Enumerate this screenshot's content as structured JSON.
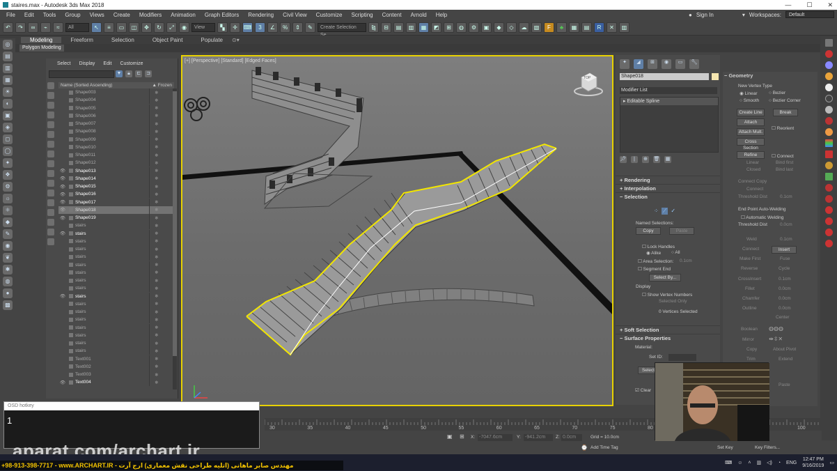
{
  "window": {
    "title": "staires.max - Autodesk 3ds Max 2018",
    "min": "—",
    "max": "☐",
    "close": "✕"
  },
  "menu": {
    "items": [
      "File",
      "Edit",
      "Tools",
      "Group",
      "Views",
      "Create",
      "Modifiers",
      "Animation",
      "Graph Editors",
      "Rendering",
      "Civil View",
      "Customize",
      "Scripting",
      "Content",
      "Arnold",
      "Help"
    ],
    "sign_in": "Sign In",
    "workspaces_label": "Workspaces:",
    "workspaces_value": "Default"
  },
  "toolbar": {
    "filter": "All",
    "view": "View",
    "selection_set": "Create Selection Se"
  },
  "ribbon": {
    "tabs": [
      "Modeling",
      "Freeform",
      "Selection",
      "Object Paint",
      "Populate"
    ],
    "active": "Modeling",
    "sub": "Polygon Modeling"
  },
  "explorer": {
    "menu": [
      "Select",
      "Display",
      "Edit",
      "Customize"
    ],
    "col_name": "Name (Sorted Ascending)",
    "col_frozen": "▲ Frozen",
    "rows": [
      {
        "name": "Shape003",
        "vis": false
      },
      {
        "name": "Shape004",
        "vis": false
      },
      {
        "name": "Shape005",
        "vis": false
      },
      {
        "name": "Shape006",
        "vis": false
      },
      {
        "name": "Shape007",
        "vis": false
      },
      {
        "name": "Shape008",
        "vis": false
      },
      {
        "name": "Shape009",
        "vis": false
      },
      {
        "name": "Shape010",
        "vis": false
      },
      {
        "name": "Shape011",
        "vis": false
      },
      {
        "name": "Shape012",
        "vis": false
      },
      {
        "name": "Shape013",
        "vis": true
      },
      {
        "name": "Shape014",
        "vis": true
      },
      {
        "name": "Shape015",
        "vis": true
      },
      {
        "name": "Shape016",
        "vis": true
      },
      {
        "name": "Shape017",
        "vis": true
      },
      {
        "name": "Shape018",
        "vis": true,
        "sel": true
      },
      {
        "name": "Shape019",
        "vis": true
      },
      {
        "name": "stairs",
        "vis": false
      },
      {
        "name": "stairs",
        "vis": true
      },
      {
        "name": "stairs",
        "vis": false
      },
      {
        "name": "stairs",
        "vis": false
      },
      {
        "name": "stairs",
        "vis": false
      },
      {
        "name": "stairs",
        "vis": false
      },
      {
        "name": "stairs",
        "vis": false
      },
      {
        "name": "stairs",
        "vis": false
      },
      {
        "name": "stairs",
        "vis": false
      },
      {
        "name": "stairs",
        "vis": true
      },
      {
        "name": "stairs",
        "vis": false
      },
      {
        "name": "stairs",
        "vis": false
      },
      {
        "name": "stairs",
        "vis": false
      },
      {
        "name": "stairs",
        "vis": false
      },
      {
        "name": "stairs",
        "vis": false
      },
      {
        "name": "stairs",
        "vis": false
      },
      {
        "name": "stairs",
        "vis": false
      },
      {
        "name": "Text001",
        "vis": false
      },
      {
        "name": "Text002",
        "vis": false
      },
      {
        "name": "Text003",
        "vis": false
      },
      {
        "name": "Text004",
        "vis": true
      }
    ]
  },
  "viewport": {
    "label": "[+] [Perspective] [Standard] [Edged Faces]",
    "cube_label": "TOP"
  },
  "command_panel": {
    "object_name": "Shape018",
    "modifier_list": "Modifier List",
    "stack_item": "Editable Spline",
    "rollouts": {
      "rendering": "Rendering",
      "interpolation": "Interpolation",
      "selection": "Selection",
      "soft_selection": "Soft Selection",
      "surface_properties": "Surface Properties"
    },
    "named_selections": "Named Selections:",
    "copy": "Copy",
    "paste": "Paste",
    "lock_handles": "Lock Handles",
    "alike": "Alike",
    "all": "All",
    "area_selection": "Area Selection:",
    "area_value": "0.1cm",
    "segment_end": "Segment End",
    "select_by": "Select By...",
    "display": "Display",
    "show_vertex_numbers": "Show Vertex Numbers",
    "selected_only": "Selected Only",
    "vertices_selected": "0 Vertices Selected",
    "material": "Material:",
    "set_id": "Set ID:",
    "select_id": "Select",
    "clear_selection": "Clear"
  },
  "geometry": {
    "title": "Geometry",
    "new_vertex_type": "New Vertex Type",
    "linear": "Linear",
    "bezier": "Bezier",
    "smooth": "Smooth",
    "bezier_corner": "Bezier Corner",
    "create_line": "Create Line",
    "break": "Break",
    "attach": "Attach",
    "reorient": "Reorient",
    "attach_mult": "Attach Mult.",
    "cross_section": "Cross Section",
    "refine": "Refine",
    "connect": "Connect",
    "linear2": "Linear",
    "bind_first": "Bind first",
    "closed": "Closed",
    "bind_last": "Bind last",
    "connect_copy": "Connect Copy",
    "connect2": "Connect",
    "threshold_dist": "Threshold Dist",
    "threshold_value": "0.1cm",
    "end_point_auto": "End Point Auto-Welding",
    "automatic_welding": "Automatic Welding",
    "threshold_dist2": "Threshold Dist",
    "threshold_value2": "0.0cm",
    "weld": "Weld",
    "weld_value": "0.1cm",
    "connect3": "Connect",
    "insert": "Insert",
    "make_first": "Make First",
    "fuse": "Fuse",
    "reverse": "Reverse",
    "cycle": "Cycle",
    "crossinsert": "CrossInsert",
    "crossinsert_value": "0.1cm",
    "fillet": "Fillet",
    "fillet_value": "0.0cm",
    "chamfer": "Chamfer",
    "chamfer_value": "0.0cm",
    "outline": "Outline",
    "outline_value": "0.0cm",
    "center": "Center",
    "boolean": "Boolean",
    "mirror": "Mirror",
    "copy": "Copy",
    "about_pivot": "About Pivot",
    "trim": "Trim",
    "extend": "Extend",
    "paste": "Paste"
  },
  "timeline": {
    "ticks": [
      "30",
      "35",
      "40",
      "45",
      "50",
      "55",
      "60",
      "65",
      "70",
      "75",
      "80",
      "100"
    ]
  },
  "status": {
    "x_label": "X:",
    "x_value": "-7047.6cm",
    "y_label": "Y:",
    "y_value": "-941.2cm",
    "z_label": "Z:",
    "z_value": "0.0cm",
    "grid": "Grid = 10.0cm",
    "add_time_tag": "Add Time Tag",
    "set_key": "Set Key",
    "key_filters": "Key Filters..."
  },
  "osd": {
    "title": "OSD hotkey",
    "value": "1"
  },
  "watermark": "aparat.com/archart.ir",
  "banner": "+98-913-398-7717 - www.ARCHART.IR - مهندس صابر ماهانی (اتلیه طراحی نقش معماری) ارج آرت",
  "tray": {
    "lang": "ENG",
    "time": "12:47 PM",
    "date": "9/16/2019"
  },
  "colors": {
    "viewport_border": "#e8d200",
    "spline": "#f2e600",
    "selected_row": "#737373",
    "accent": "#5f7fa6"
  }
}
